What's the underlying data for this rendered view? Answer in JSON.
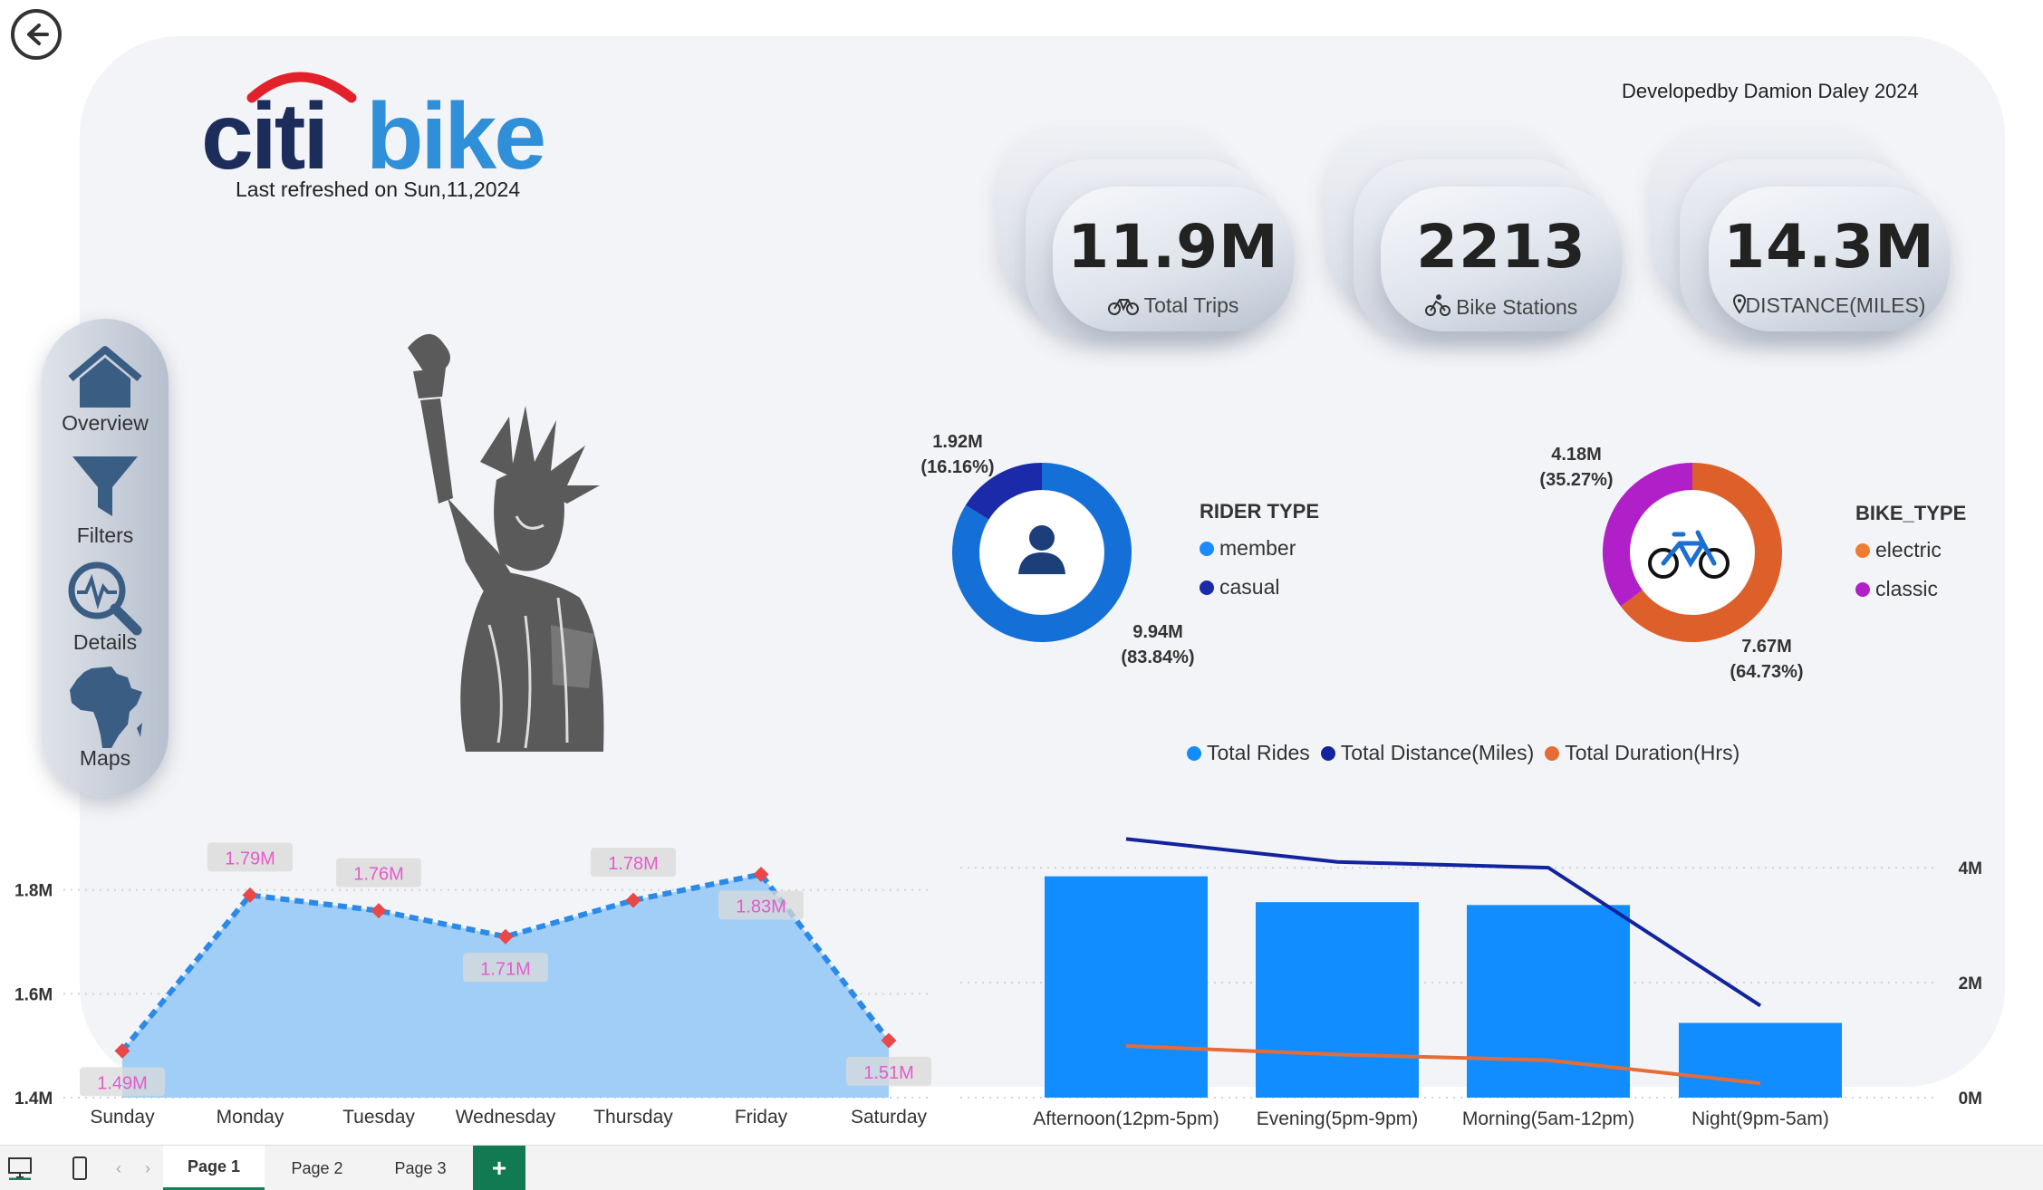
{
  "header": {
    "refresh_text": "Last refreshed on Sun,11,2024",
    "developer_text": "Developedby Damion Daley 2024",
    "brand_left": "citi",
    "brand_right": "bike"
  },
  "kpis": [
    {
      "value": "11.9M",
      "label": "Total Trips",
      "icon": "bicycle-icon"
    },
    {
      "value": "2213",
      "label": "Bike Stations",
      "icon": "rider-icon"
    },
    {
      "value": "14.3M",
      "label": "DISTANCE(MILES)",
      "icon": "location-pin-icon"
    }
  ],
  "nav": {
    "items": [
      {
        "label": "Overview",
        "icon": "home-icon"
      },
      {
        "label": "Filters",
        "icon": "funnel-icon"
      },
      {
        "label": "Details",
        "icon": "magnifier-pulse-icon"
      },
      {
        "label": "Maps",
        "icon": "africa-map-icon"
      }
    ]
  },
  "rider_donut": {
    "legend_title": "RIDER TYPE",
    "legend": [
      "member",
      "casual"
    ],
    "top_label_value": "1.92M",
    "top_label_pct": "(16.16%)",
    "bottom_label_value": "9.94M",
    "bottom_label_pct": "(83.84%)"
  },
  "bike_donut": {
    "legend_title": "BIKE_TYPE",
    "legend": [
      "electric",
      "classic"
    ],
    "top_label_value": "4.18M",
    "top_label_pct": "(35.27%)",
    "bottom_label_value": "7.67M",
    "bottom_label_pct": "(64.73%)"
  },
  "combo_legend": [
    "Total Rides",
    "Total Distance(Miles)",
    "Total Duration(Hrs)"
  ],
  "colors": {
    "member": "#1a8cff",
    "casual": "#1a2aa8",
    "electric": "#f07c33",
    "classic": "#b01fc7",
    "bar": "#118dff",
    "distance_line": "#12239e",
    "duration_line": "#e66c37",
    "area_fill": "#9ccbf6",
    "area_line": "#2b8ae8"
  },
  "chart_data": [
    {
      "type": "area",
      "categories": [
        "Sunday",
        "Monday",
        "Tuesday",
        "Wednesday",
        "Thursday",
        "Friday",
        "Saturday"
      ],
      "values": [
        1.49,
        1.79,
        1.76,
        1.71,
        1.78,
        1.83,
        1.51
      ],
      "data_labels": [
        "1.49M",
        "1.79M",
        "1.76M",
        "1.71M",
        "1.78M",
        "1.83M",
        "1.51M"
      ],
      "y_ticks": [
        "1.4M",
        "1.6M",
        "1.8M"
      ],
      "ylim": [
        1.4,
        1.85
      ],
      "grid": true
    },
    {
      "type": "bar",
      "categories": [
        "Afternoon(12pm-5pm)",
        "Evening(5pm-9pm)",
        "Morning(5am-12pm)",
        "Night(9pm-5am)"
      ],
      "series": [
        {
          "name": "Total Rides",
          "type": "bar",
          "values": [
            3.85,
            3.4,
            3.35,
            1.3
          ]
        },
        {
          "name": "Total Distance(Miles)",
          "type": "line",
          "values": [
            4.5,
            4.1,
            4.0,
            1.6
          ]
        },
        {
          "name": "Total Duration(Hrs)",
          "type": "line",
          "values": [
            0.9,
            0.75,
            0.65,
            0.25
          ]
        }
      ],
      "y_ticks": [
        "0M",
        "2M",
        "4M"
      ],
      "ylim": [
        0,
        4.6
      ],
      "legend": "top"
    }
  ],
  "tabs": {
    "items": [
      "Page 1",
      "Page 2",
      "Page 3"
    ],
    "add_label": "+"
  }
}
